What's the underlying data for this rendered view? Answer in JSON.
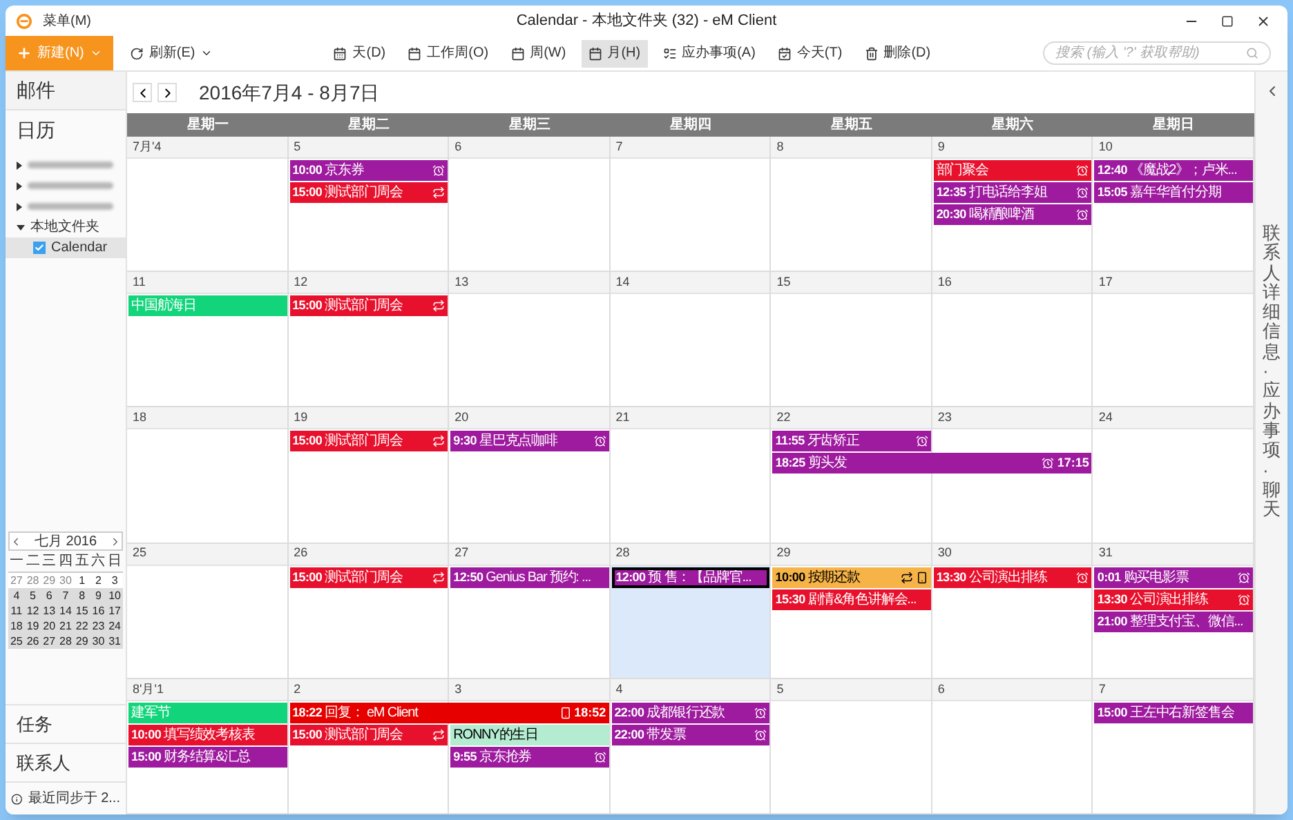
{
  "window": {
    "menu": "菜单(M)",
    "title": "Calendar - 本地文件夹 (32) - eM Client"
  },
  "toolbar": {
    "new_button": "新建(N)",
    "refresh_button": "刷新(E)",
    "views": [
      {
        "label": "天(D)",
        "selected": false
      },
      {
        "label": "工作周(O)",
        "selected": false
      },
      {
        "label": "周(W)",
        "selected": false
      },
      {
        "label": "月(H)",
        "selected": true
      },
      {
        "label": "应办事项(A)",
        "selected": false
      },
      {
        "label": "今天(T)",
        "selected": false
      },
      {
        "label": "删除(D)",
        "selected": false
      }
    ],
    "search": {
      "placeholder": "搜索 (输入 '?' 获取帮助)"
    }
  },
  "sidebar": {
    "sections_top": [
      {
        "label": "邮件"
      },
      {
        "label": "日历"
      }
    ],
    "folders": [
      {
        "kind": "redacted",
        "expanded": false
      },
      {
        "kind": "redacted",
        "expanded": false
      },
      {
        "kind": "redacted",
        "expanded": false
      },
      {
        "kind": "folder",
        "label": "本地文件夹",
        "expanded": true,
        "children": [
          {
            "label": "Calendar",
            "checked": true,
            "selected": true
          }
        ]
      }
    ],
    "mini_calendar": {
      "title": "七月 2016",
      "weekdays": [
        "一",
        "二",
        "三",
        "四",
        "五",
        "六",
        "日"
      ],
      "rows": [
        {
          "shaded": false,
          "days": [
            {
              "label": "27",
              "outside": true
            },
            {
              "label": "28",
              "outside": true
            },
            {
              "label": "29",
              "outside": true
            },
            {
              "label": "30",
              "outside": true
            },
            {
              "label": "1",
              "outside": false
            },
            {
              "label": "2",
              "outside": false
            },
            {
              "label": "3",
              "outside": false
            }
          ]
        },
        {
          "shaded": true,
          "days": [
            {
              "label": "4",
              "outside": false
            },
            {
              "label": "5",
              "outside": false
            },
            {
              "label": "6",
              "outside": false
            },
            {
              "label": "7",
              "outside": false
            },
            {
              "label": "8",
              "outside": false
            },
            {
              "label": "9",
              "outside": false
            },
            {
              "label": "10",
              "outside": false
            }
          ]
        },
        {
          "shaded": true,
          "days": [
            {
              "label": "11",
              "outside": false
            },
            {
              "label": "12",
              "outside": false
            },
            {
              "label": "13",
              "outside": false
            },
            {
              "label": "14",
              "outside": false
            },
            {
              "label": "15",
              "outside": false
            },
            {
              "label": "16",
              "outside": false
            },
            {
              "label": "17",
              "outside": false
            }
          ]
        },
        {
          "shaded": true,
          "days": [
            {
              "label": "18",
              "outside": false
            },
            {
              "label": "19",
              "outside": false
            },
            {
              "label": "20",
              "outside": false
            },
            {
              "label": "21",
              "outside": false
            },
            {
              "label": "22",
              "outside": false
            },
            {
              "label": "23",
              "outside": false
            },
            {
              "label": "24",
              "outside": false
            }
          ]
        },
        {
          "shaded": true,
          "days": [
            {
              "label": "25",
              "outside": false
            },
            {
              "label": "26",
              "outside": false
            },
            {
              "label": "27",
              "outside": false
            },
            {
              "label": "28",
              "outside": false
            },
            {
              "label": "29",
              "outside": false
            },
            {
              "label": "30",
              "outside": false
            },
            {
              "label": "31",
              "outside": false
            }
          ]
        }
      ]
    },
    "sections_bottom": [
      {
        "label": "任务"
      },
      {
        "label": "联系人"
      }
    ],
    "sync_status": "最近同步于 2..."
  },
  "calendar": {
    "range": "2016年7月4 - 8月7日",
    "weekdays": [
      "星期一",
      "星期二",
      "星期三",
      "星期四",
      "星期五",
      "星期六",
      "星期日"
    ],
    "weeks": [
      {
        "days": [
          {
            "label": "7月'4",
            "selected": false
          },
          {
            "label": "5",
            "selected": false,
            "events": [
              {
                "kind": "single",
                "time": "10:00",
                "title": "京东券",
                "color": "#9e1a9e",
                "selected": false,
                "reminder": true
              },
              {
                "kind": "single",
                "time": "15:00",
                "title": "测试部门周会",
                "color": "#e8112d",
                "selected": false,
                "recurring": true
              }
            ]
          },
          {
            "label": "6",
            "selected": false
          },
          {
            "label": "7",
            "selected": false
          },
          {
            "label": "8",
            "selected": false
          },
          {
            "label": "9",
            "selected": false,
            "events": [
              {
                "kind": "single",
                "title": "部门聚会",
                "color": "#e8112d",
                "selected": false,
                "reminder": true
              },
              {
                "kind": "single",
                "time": "12:35",
                "title": "打电话给李姐",
                "color": "#9e1a9e",
                "selected": false,
                "reminder": true
              },
              {
                "kind": "single",
                "time": "20:30",
                "title": "喝精酿啤酒",
                "color": "#9e1a9e",
                "selected": false,
                "reminder": true
              }
            ]
          },
          {
            "label": "10",
            "selected": false,
            "events": [
              {
                "kind": "single",
                "time": "12:40",
                "title": "《魔战2》；卢米...",
                "color": "#9e1a9e",
                "selected": false
              },
              {
                "kind": "single",
                "time": "15:05",
                "title": "嘉年华首付分期",
                "color": "#9e1a9e",
                "selected": false
              }
            ]
          }
        ]
      },
      {
        "days": [
          {
            "label": "11",
            "selected": false,
            "events": [
              {
                "kind": "single",
                "title": "中国航海日",
                "color": "#12d57b",
                "selected": false
              }
            ]
          },
          {
            "label": "12",
            "selected": false,
            "events": [
              {
                "kind": "single",
                "time": "15:00",
                "title": "测试部门周会",
                "color": "#e8112d",
                "selected": false,
                "recurring": true
              }
            ]
          },
          {
            "label": "13",
            "selected": false
          },
          {
            "label": "14",
            "selected": false
          },
          {
            "label": "15",
            "selected": false
          },
          {
            "label": "16",
            "selected": false
          },
          {
            "label": "17",
            "selected": false
          }
        ]
      },
      {
        "days": [
          {
            "label": "18",
            "selected": false
          },
          {
            "label": "19",
            "selected": false,
            "events": [
              {
                "kind": "single",
                "time": "15:00",
                "title": "测试部门周会",
                "color": "#e8112d",
                "selected": false,
                "recurring": true
              }
            ]
          },
          {
            "label": "20",
            "selected": false,
            "events": [
              {
                "kind": "single",
                "time": "9:30",
                "title": "星巴克点咖啡",
                "color": "#9e1a9e",
                "selected": false,
                "reminder": true
              }
            ]
          },
          {
            "label": "21",
            "selected": false
          },
          {
            "label": "22",
            "selected": false,
            "events": [
              {
                "kind": "single",
                "time": "11:55",
                "title": "牙齿矫正",
                "color": "#9e1a9e",
                "selected": false,
                "reminder": true
              },
              {
                "kind": "two_day",
                "time": "18:25",
                "title": "剪头发",
                "end_time": "17:15",
                "color": "#9e1a9e",
                "selected": false,
                "reminder": true
              }
            ]
          },
          {
            "label": "23",
            "selected": false
          },
          {
            "label": "24",
            "selected": false
          }
        ]
      },
      {
        "days": [
          {
            "label": "25",
            "selected": false
          },
          {
            "label": "26",
            "selected": false,
            "events": [
              {
                "kind": "single",
                "time": "15:00",
                "title": "测试部门周会",
                "color": "#e8112d",
                "selected": false,
                "recurring": true
              }
            ]
          },
          {
            "label": "27",
            "selected": false,
            "events": [
              {
                "kind": "single",
                "time": "12:50",
                "title": "Genius Bar 预约: ...",
                "color": "#9e1a9e",
                "selected": false
              }
            ]
          },
          {
            "label": "28",
            "selected": true,
            "events": [
              {
                "kind": "single",
                "time": "12:00",
                "title": "预 售：【品牌官...",
                "color": "#9e1a9e",
                "selected": true
              }
            ]
          },
          {
            "label": "29",
            "selected": false,
            "events": [
              {
                "kind": "single",
                "time": "10:00",
                "title": "按期还款",
                "color": "#f6b347",
                "selected": false,
                "recurring": true,
                "device": true
              },
              {
                "kind": "single",
                "time": "15:30",
                "title": "剧情&角色讲解会...",
                "color": "#e8112d",
                "selected": false
              }
            ]
          },
          {
            "label": "30",
            "selected": false,
            "events": [
              {
                "kind": "single",
                "time": "13:30",
                "title": "公司演出排练",
                "color": "#e8112d",
                "selected": false,
                "reminder": true
              }
            ]
          },
          {
            "label": "31",
            "selected": false,
            "events": [
              {
                "kind": "single",
                "time": "0:01",
                "title": "购买电影票",
                "color": "#9e1a9e",
                "selected": false,
                "reminder": true
              },
              {
                "kind": "single",
                "time": "13:30",
                "title": "公司演出排练",
                "color": "#e8112d",
                "selected": false,
                "reminder": true
              },
              {
                "kind": "single",
                "time": "21:00",
                "title": "整理支付宝、微信...",
                "color": "#9e1a9e",
                "selected": false
              }
            ]
          }
        ]
      },
      {
        "days": [
          {
            "label": "8'月'1",
            "selected": false,
            "events": [
              {
                "kind": "single",
                "title": "建军节",
                "color": "#12d57b",
                "selected": false
              },
              {
                "kind": "single",
                "time": "10:00",
                "title": "填写绩效考核表",
                "color": "#e8112d",
                "selected": false
              },
              {
                "kind": "single",
                "time": "15:00",
                "title": "财务结算&汇总",
                "color": "#9e1a9e",
                "selected": false
              }
            ]
          },
          {
            "label": "2",
            "selected": false,
            "events": [
              {
                "kind": "two_day",
                "time": "18:22",
                "title": "回复： eM Client",
                "end_time": "18:52",
                "color": "#e60000",
                "selected": false,
                "device": true
              },
              {
                "kind": "single",
                "time": "15:00",
                "title": "测试部门周会",
                "color": "#e8112d",
                "selected": false,
                "recurring": true
              }
            ]
          },
          {
            "label": "3",
            "selected": false,
            "events": [
              {
                "kind": "single",
                "title": "RONNY的生日",
                "color": "#b4ecd2",
                "selected": false
              },
              {
                "kind": "single",
                "time": "9:55",
                "title": "京东抢券",
                "color": "#9e1a9e",
                "selected": false,
                "reminder": true
              }
            ]
          },
          {
            "label": "4",
            "selected": false,
            "events": [
              {
                "kind": "single",
                "time": "22:00",
                "title": "成都银行还款",
                "color": "#9e1a9e",
                "selected": false,
                "reminder": true
              },
              {
                "kind": "single",
                "time": "22:00",
                "title": "带发票",
                "color": "#9e1a9e",
                "selected": false,
                "reminder": true
              }
            ]
          },
          {
            "label": "5",
            "selected": false
          },
          {
            "label": "6",
            "selected": false
          },
          {
            "label": "7",
            "selected": false,
            "events": [
              {
                "kind": "single",
                "time": "15:00",
                "title": "王左中右新签售会",
                "color": "#9e1a9e",
                "selected": false
              }
            ]
          }
        ]
      }
    ]
  },
  "right_panel": {
    "label": "联系人详细信息·应办事项·聊天"
  }
}
